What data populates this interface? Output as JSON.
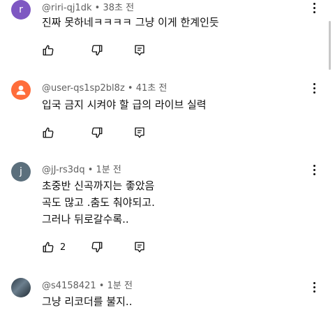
{
  "comments": [
    {
      "avatar_letter": "r",
      "avatar_color": "#7E57C2",
      "author": "@riri-qj1dk",
      "time": "38초 전",
      "lines": [
        "진짜 못하네ㅋㅋㅋㅋ 그냥 이게 한계인듯"
      ],
      "likes": ""
    },
    {
      "avatar_letter": "",
      "avatar_color": "#FF6D3B",
      "author": "@user-qs1sp2bl8z",
      "time": "41초 전",
      "lines": [
        "입국 금지 시켜야 할 급의 라이브 실력"
      ],
      "likes": ""
    },
    {
      "avatar_letter": "j",
      "avatar_color": "#5B6F7C",
      "author": "@jJ-rs3dq",
      "time": "1분 전",
      "lines": [
        "초중반 신곡까지는 좋았음",
        "곡도 많고 .춤도 춰야되고.",
        "그러나 뒤로갈수록.."
      ],
      "likes": "2"
    },
    {
      "avatar_letter": "",
      "avatar_color": "#3B4D5C",
      "author": "@s4158421",
      "time": "1분 전",
      "lines": [
        "그냥 리코더를 불지.."
      ],
      "likes": ""
    }
  ],
  "separator": " • ",
  "icons": [
    "like-icon",
    "dislike-icon",
    "reply-icon",
    "more-icon",
    "person-icon"
  ]
}
